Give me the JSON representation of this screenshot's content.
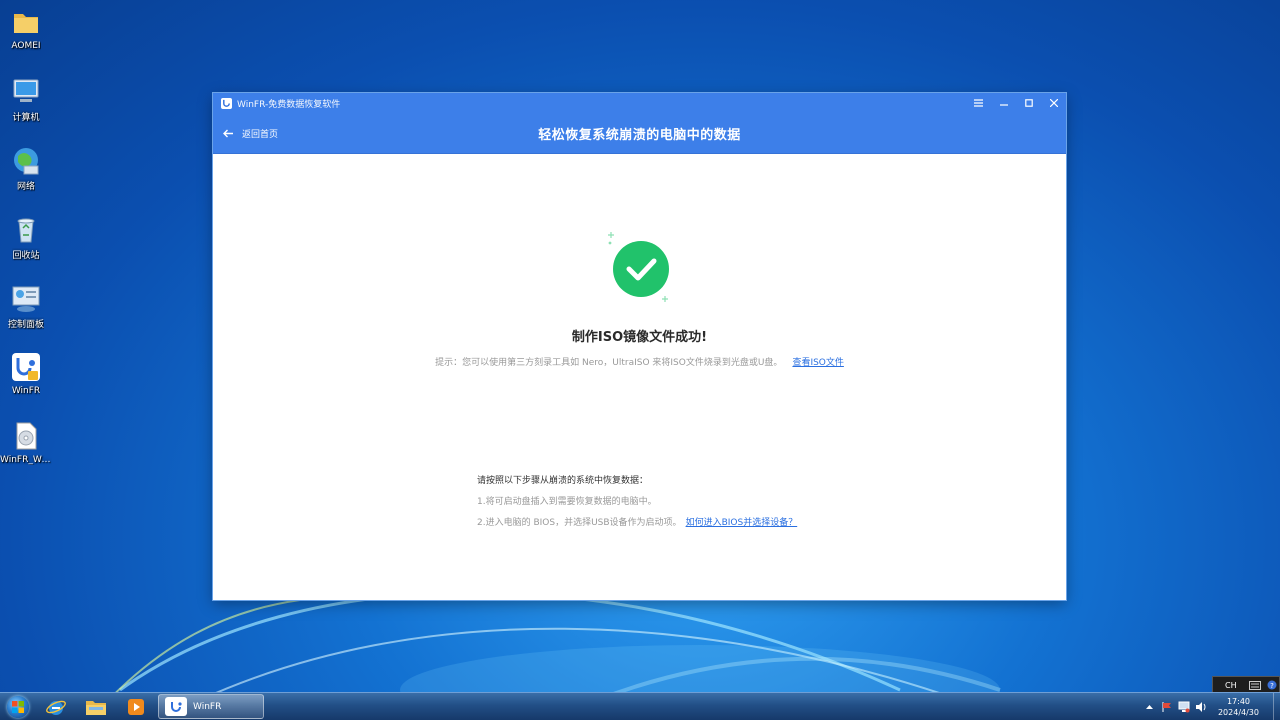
{
  "desktop": {
    "icons": [
      {
        "label": "AOMEI",
        "icon": "folder-icon"
      },
      {
        "label": "计算机",
        "icon": "computer-icon"
      },
      {
        "label": "网络",
        "icon": "network-icon"
      },
      {
        "label": "回收站",
        "icon": "recycle-bin-icon"
      },
      {
        "label": "控制面板",
        "icon": "control-panel-icon"
      },
      {
        "label": "WinFR",
        "icon": "winfr-icon"
      },
      {
        "label": "WinFR_Wi...",
        "icon": "disc-image-file-icon"
      }
    ]
  },
  "window": {
    "title": "WinFR-免费数据恢复软件",
    "back_label": "返回首页",
    "header_title": "轻松恢复系统崩溃的电脑中的数据",
    "success_title": "制作ISO镜像文件成功!",
    "tip_text": "提示：您可以使用第三方刻录工具如 Nero，UltraISO 来将ISO文件烧录到光盘或U盘。",
    "tip_link": "查看ISO文件",
    "steps_heading": "请按照以下步骤从崩溃的系统中恢复数据：",
    "step1": "1.将可启动盘插入到需要恢复数据的电脑中。",
    "step2": "2.进入电脑的 BIOS，并选择USB设备作为启动项。",
    "step2_link": "如何进入BIOS并选择设备？",
    "accent_color": "#3d7fe9",
    "success_color": "#21c26b"
  },
  "taskbar": {
    "active_app_label": "WinFR",
    "time": "17:40",
    "date": "2024/4/30",
    "language": "CH"
  }
}
